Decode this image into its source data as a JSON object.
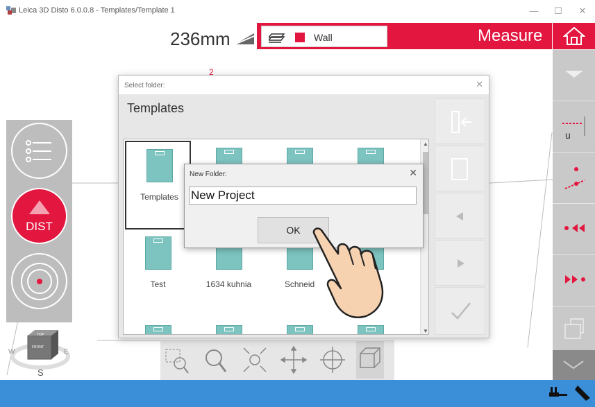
{
  "window": {
    "title": "Leica 3D Disto 6.0.0.8 - Templates/Template 1",
    "buttons": [
      "—",
      "☐",
      "✕"
    ]
  },
  "toolbar": {
    "distance": "236mm",
    "layer_name": "Wall",
    "layer_color": "#e3163f",
    "mode": "Measure"
  },
  "left_panel": {
    "dist_label": "DIST",
    "compass": {
      "west": "W",
      "east": "E",
      "south": "S",
      "top": "TOP",
      "front": "FRONT"
    }
  },
  "select_folder": {
    "caption": "Select folder:",
    "heading": "Templates",
    "folders": [
      {
        "label": "Templates",
        "selected": true
      },
      {
        "label": "",
        "selected": false
      },
      {
        "label": "",
        "selected": false
      },
      {
        "label": "",
        "selected": false
      },
      {
        "label": "Test",
        "selected": false
      },
      {
        "label": "1634 kuhnia",
        "selected": false
      },
      {
        "label": "Schneid",
        "selected": false
      },
      {
        "label": "",
        "selected": false
      }
    ]
  },
  "new_folder": {
    "caption": "New Folder:",
    "value": "New Project",
    "ok_label": "OK"
  },
  "canvas": {
    "marker": "2"
  },
  "colors": {
    "accent": "#e3163f",
    "status_bar": "#3b8fd9",
    "folder": "#7dc3bf"
  }
}
